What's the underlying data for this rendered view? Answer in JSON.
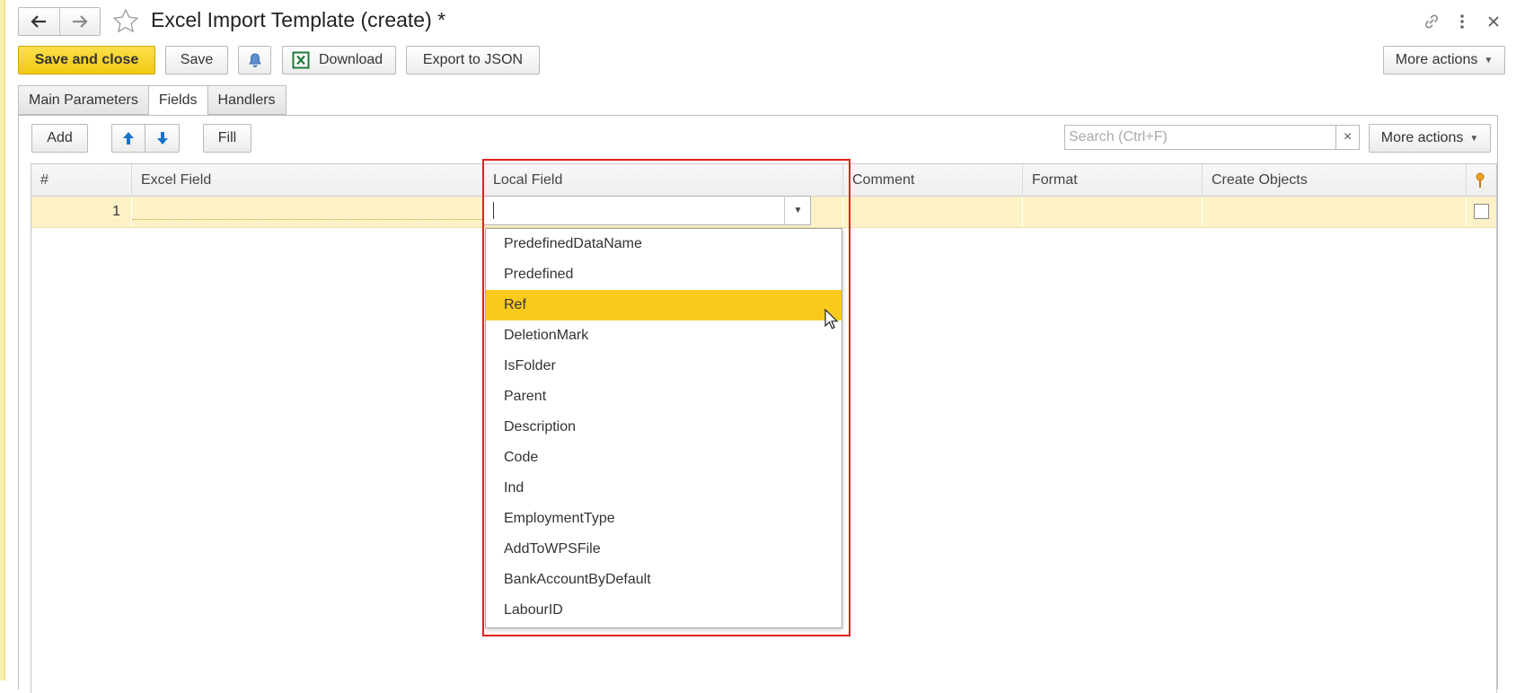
{
  "window": {
    "title": "Excel Import Template (create) *"
  },
  "toolbar": {
    "save_and_close": "Save and close",
    "save": "Save",
    "download": "Download",
    "export_json": "Export to JSON",
    "more_actions": "More actions"
  },
  "tabs": [
    {
      "label": "Main Parameters",
      "active": false
    },
    {
      "label": "Fields",
      "active": true
    },
    {
      "label": "Handlers",
      "active": false
    }
  ],
  "fields_toolbar": {
    "add": "Add",
    "fill": "Fill",
    "search_placeholder": "Search (Ctrl+F)",
    "clear": "×",
    "more_actions": "More actions"
  },
  "table": {
    "columns": [
      "#",
      "Excel Field",
      "Local Field",
      "Comment",
      "Format",
      "Create Objects"
    ],
    "rows": [
      {
        "num": "1",
        "excel_field": "",
        "local_field": "",
        "comment": "",
        "format": "",
        "create_objects": false
      }
    ]
  },
  "dropdown": {
    "items": [
      "PredefinedDataName",
      "Predefined",
      "Ref",
      "DeletionMark",
      "IsFolder",
      "Parent",
      "Description",
      "Code",
      "Ind",
      "EmploymentType",
      "AddToWPSFile",
      "BankAccountByDefault",
      "LabourID"
    ],
    "selected": "Ref"
  },
  "colors": {
    "primary_button": "#f2c810",
    "selected_item": "#f9c91e",
    "row_highlight": "#fdf2c7",
    "annotation_box": "#e0201e",
    "excel_icon": "#1f7a3a",
    "arrow_icon": "#1a73c8"
  },
  "icons": [
    "back-arrow-icon",
    "forward-arrow-icon",
    "star-icon",
    "link-icon",
    "kebab-menu-icon",
    "close-icon",
    "bell-icon",
    "excel-icon",
    "arrow-up-icon",
    "arrow-down-icon",
    "pin-icon",
    "mouse-cursor-icon"
  ]
}
